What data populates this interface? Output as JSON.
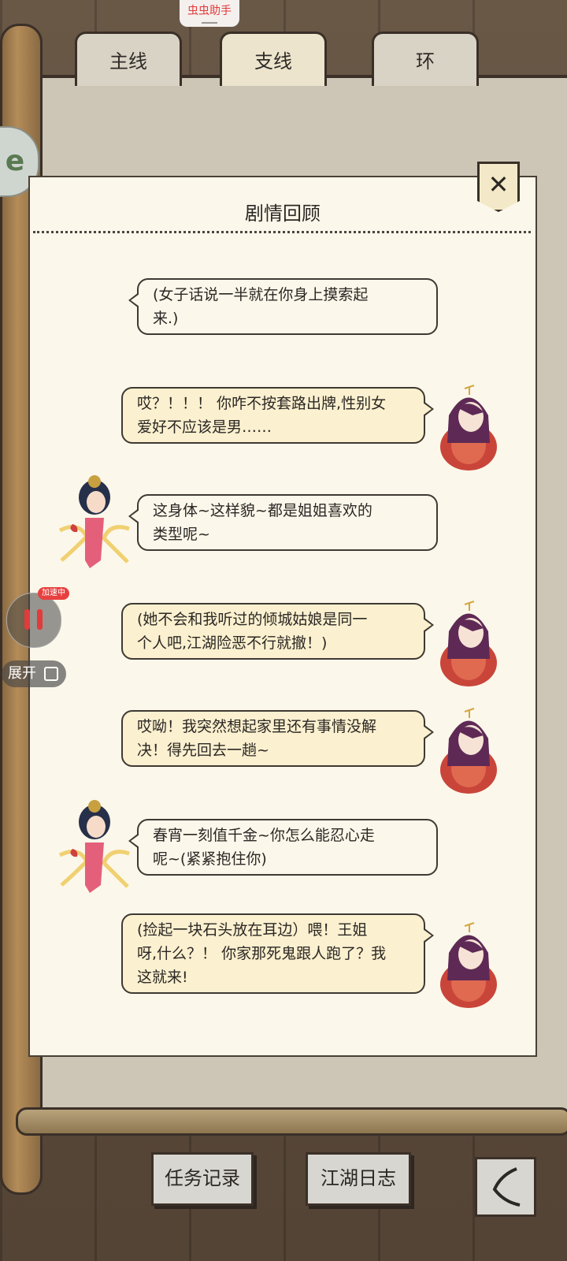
{
  "helper_label": "虫虫助手",
  "tabs": [
    {
      "label": "主线",
      "active": false
    },
    {
      "label": "支线",
      "active": true
    },
    {
      "label": "环",
      "active": false
    }
  ],
  "panel": {
    "title": "剧情回顾",
    "close_icon": "close-icon"
  },
  "dialogues": [
    {
      "speaker": "none",
      "style": "white",
      "text_line1": "(女子话说一半就在你身上摸索起",
      "text_line2": "来.)"
    },
    {
      "speaker": "player",
      "style": "yellow",
      "text_line1": "哎？！！！ 你咋不按套路出牌,性别女",
      "text_line2": "爱好不应该是男……"
    },
    {
      "speaker": "npc",
      "style": "white",
      "text_line1": "这身体~这样貌~都是姐姐喜欢的",
      "text_line2": "类型呢~"
    },
    {
      "speaker": "player",
      "style": "yellow",
      "text_line1": "(她不会和我听过的倾城姑娘是同一",
      "text_line2": "个人吧,江湖险恶不行就撤！)"
    },
    {
      "speaker": "player",
      "style": "yellow",
      "text_line1": "哎呦！我突然想起家里还有事情没解",
      "text_line2": "决！得先回去一趟~"
    },
    {
      "speaker": "npc",
      "style": "white",
      "text_line1": "春宵一刻值千金~你怎么能忍心走",
      "text_line2": "呢~(紧紧抱住你)"
    },
    {
      "speaker": "player",
      "style": "yellow",
      "text_line1": "(捡起一块石头放在耳边）喂！王姐",
      "text_line2": "呀,什么？！ 你家那死鬼跟人跑了？我",
      "text_line3": "这就来!"
    }
  ],
  "overlay": {
    "speed_badge": "加速中",
    "expand_label": "展开"
  },
  "bottom": {
    "task_record": "任务记录",
    "jianghu_log": "江湖日志",
    "back_icon": "back-icon"
  },
  "colors": {
    "panel_bg": "#fbf7ea",
    "bubble_yellow": "#fbf0cf",
    "outline": "#3b3028",
    "accent_red": "#e33a3a"
  }
}
